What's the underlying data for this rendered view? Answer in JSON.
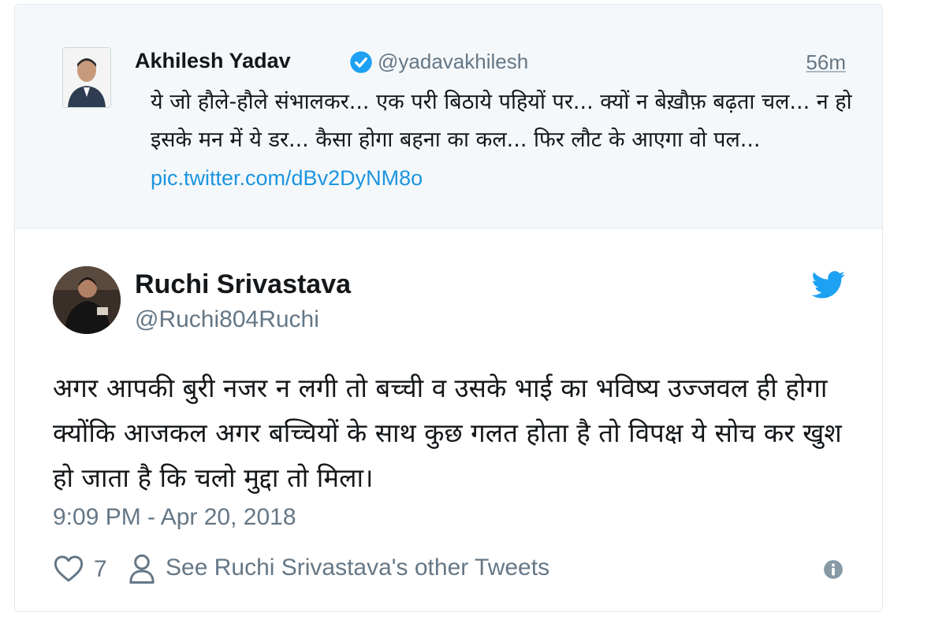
{
  "quoted_tweet": {
    "author_name": "Akhilesh Yadav",
    "author_handle": "@yadavakhilesh",
    "time_ago": "56m",
    "text": "ये जो हौले-हौले संभालकर... एक परी बिठाये पहियों पर... क्यों न बेख़ौफ़ बढ़ता चल... न हो इसके मन में ये डर... कैसा होगा बहना का कल... फिर लौट के आएगा वो पल...",
    "link": "pic.twitter.com/dBv2DyNM8o"
  },
  "tweet": {
    "author_name": "Ruchi Srivastava",
    "author_handle": "@Ruchi804Ruchi",
    "text": "अगर आपकी बुरी नजर न लगी तो बच्ची व उसके भाई का भविष्य उज्जवल ही होगा क्योंकि आजकल अगर बच्चियों के साथ कुछ गलत होता है तो विपक्ष ये सोच कर खुश हो जाता है कि चलो मुद्दा तो मिला।",
    "datetime": "9:09 PM - Apr 20, 2018",
    "like_count": "7",
    "see_other_tweets": "See Ruchi Srivastava's other Tweets"
  },
  "icons": {
    "verified": "verified-badge-icon",
    "twitter": "twitter-bird-icon",
    "like": "heart-icon",
    "profile": "person-icon",
    "info": "info-icon"
  },
  "colors": {
    "twitter_blue": "#1da1f2",
    "link_blue": "#1b95e0",
    "secondary_text": "#657786",
    "quoted_background": "#f5f8fa"
  }
}
